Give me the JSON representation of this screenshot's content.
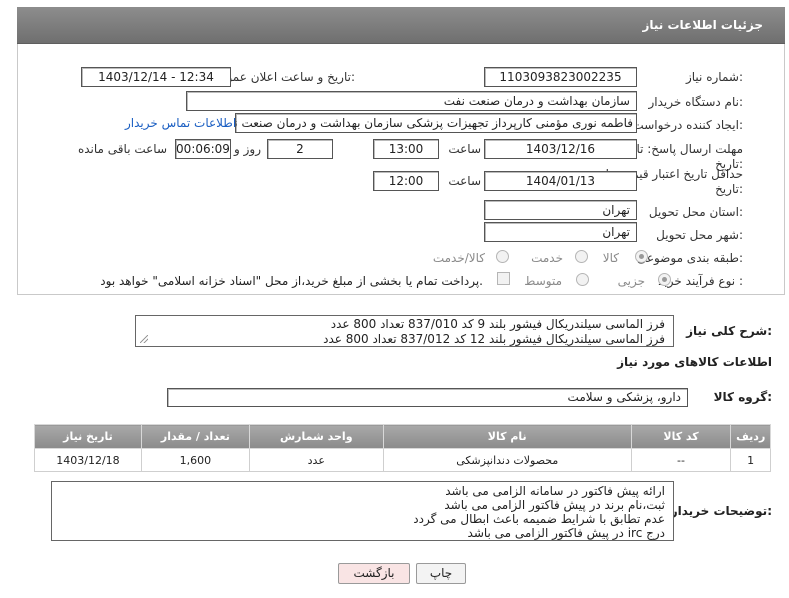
{
  "panel": {
    "title": "جزئیات اطلاعات نیاز"
  },
  "form": {
    "need_number_label": "شماره نیاز:",
    "need_number": "1103093823002235",
    "announce_label": "تاریخ و ساعت اعلان عمومی:",
    "announce_value": "1403/12/14 - 12:34",
    "buyer_org_label": "نام دستگاه خریدار:",
    "buyer_org": "سازمان بهداشت و درمان صنعت نفت",
    "creator_label": "ایجاد کننده درخواست:",
    "creator": "فاطمه نوری مؤمنی کارپرداز تجهیزات پزشکی سازمان بهداشت و درمان صنعت نفت",
    "contact_link": "اطلاعات تماس خریدار",
    "deadline_label": "مهلت ارسال پاسخ: تا",
    "deadline_label2": "تاریخ:",
    "deadline_date": "1403/12/16",
    "time_label": "ساعت",
    "deadline_time": "13:00",
    "days_value": "2",
    "days_label": "روز و",
    "remaining_value": "00:06:09",
    "remaining_label": "ساعت باقی مانده",
    "validity_label": "حداقل تاریخ اعتبار قیمت: تا",
    "validity_label2": "تاریخ:",
    "validity_date": "1404/01/13",
    "validity_time_label": "ساعت",
    "validity_time": "12:00",
    "province_label": "استان محل تحویل:",
    "province": "تهران",
    "city_label": "شهر محل تحویل:",
    "city": "تهران",
    "category_label": "طبقه بندی موضوعی:",
    "category_options": [
      "کالا",
      "خدمت",
      "کالا/خدمت"
    ],
    "process_label": "نوع فرآیند خرید :",
    "process_options": [
      "جزیی",
      "متوسط"
    ],
    "payment_note": "پرداخت تمام یا بخشی از مبلغ خرید،از محل \"اسناد خزانه اسلامی\" خواهد بود."
  },
  "description": {
    "label": "شرح کلی نیاز:",
    "lines": [
      "فرز الماسی سیلندریکال فیشور بلند 9 کد 837/010 تعداد 800 عدد",
      "فرز الماسی سیلندریکال فیشور بلند 12 کد 837/012 تعداد 800 عدد"
    ]
  },
  "goods": {
    "section_title": "اطلاعات کالاهای مورد نیاز",
    "group_label": "گروه کالا:",
    "group_value": "دارو، پزشکی و سلامت",
    "columns": [
      "ردیف",
      "کد کالا",
      "نام کالا",
      "واحد شمارش",
      "تعداد / مقدار",
      "تاریخ نیاز"
    ],
    "rows": [
      [
        "1",
        "--",
        "محصولات دندانپزشکی",
        "عدد",
        "1,600",
        "1403/12/18"
      ]
    ]
  },
  "buyer_notes": {
    "label": "توضیحات خریدار:",
    "lines": [
      "ارائه پیش فاکتور در سامانه الزامی می باشد",
      "ثبت،نام برند در پیش فاکتور الزامی می باشد",
      "عدم تطابق با شرایط ضمیمه باعث ابطال می گردد",
      "درج irc در پیش فاکتور الزامی می باشد"
    ]
  },
  "buttons": {
    "print": "چاپ",
    "back": "بازگشت"
  },
  "colors": {
    "header": "#7d7d7d",
    "link": "#1a5ec2",
    "back_button": "#f9e4e4"
  }
}
